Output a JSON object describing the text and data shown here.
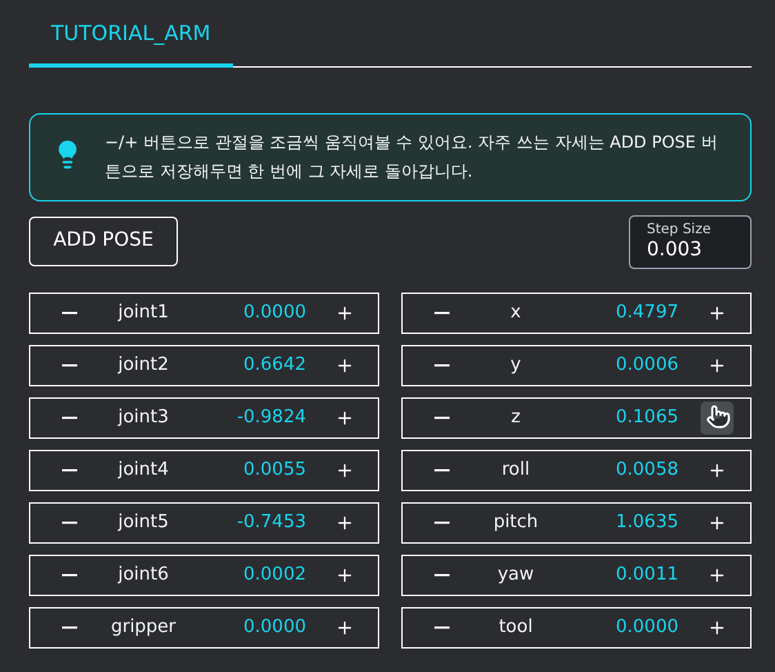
{
  "tabs": [
    {
      "label": "TUTORIAL_ARM",
      "selected": true
    }
  ],
  "info": {
    "text": "−/+ 버튼으로 관절을 조금씩 움직여볼 수 있어요. 자주 쓰는 자세는 ADD POSE 버튼으로 저장해두면 한 번에 그 자세로 돌아갑니다."
  },
  "add_pose_button": "ADD POSE",
  "step_size": {
    "label": "Step Size",
    "value": "0.003"
  },
  "joints": [
    {
      "name": "joint1",
      "value": "0.0000",
      "hovered": false
    },
    {
      "name": "joint2",
      "value": "0.6642",
      "hovered": false
    },
    {
      "name": "joint3",
      "value": "-0.9824",
      "hovered": false
    },
    {
      "name": "joint4",
      "value": "0.0055",
      "hovered": false
    },
    {
      "name": "joint5",
      "value": "-0.7453",
      "hovered": false
    },
    {
      "name": "joint6",
      "value": "0.0002",
      "hovered": false
    },
    {
      "name": "gripper",
      "value": "0.0000",
      "hovered": false
    }
  ],
  "cartesian": [
    {
      "name": "x",
      "value": "0.4797",
      "hovered": false
    },
    {
      "name": "y",
      "value": "0.0006",
      "hovered": false
    },
    {
      "name": "z",
      "value": "0.1065",
      "hovered": true
    },
    {
      "name": "roll",
      "value": "0.0058",
      "hovered": false
    },
    {
      "name": "pitch",
      "value": "1.0635",
      "hovered": false
    },
    {
      "name": "yaw",
      "value": "0.0011",
      "hovered": false
    },
    {
      "name": "tool",
      "value": "0.0000",
      "hovered": false
    }
  ]
}
